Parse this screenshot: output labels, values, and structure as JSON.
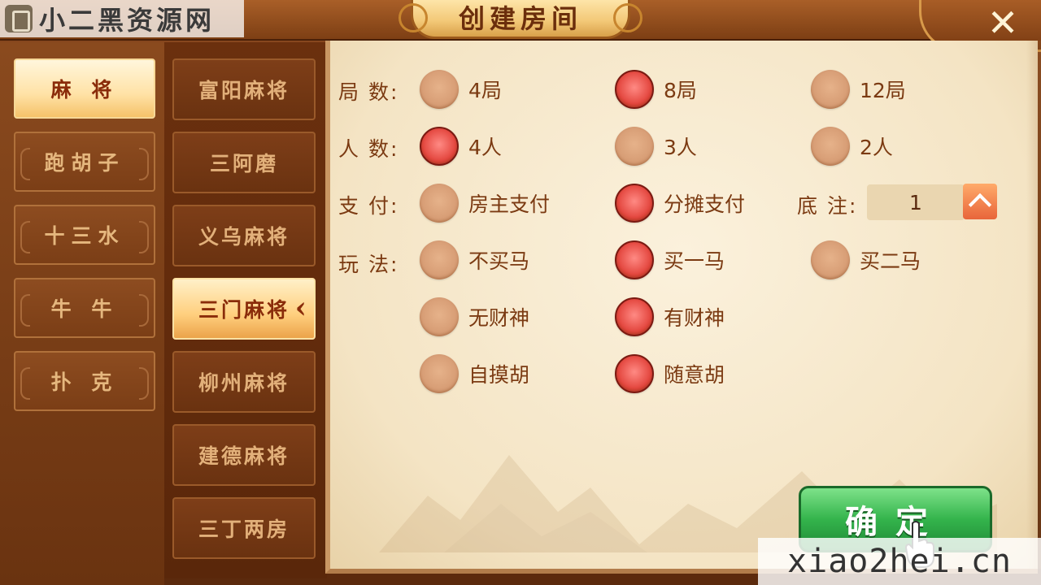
{
  "header": {
    "title": "创建房间",
    "watermark_top": "小二黑资源网",
    "close_symbol": "✕"
  },
  "categories": [
    {
      "label": "麻 将",
      "active": true
    },
    {
      "label": "跑胡子",
      "active": false
    },
    {
      "label": "十三水",
      "active": false
    },
    {
      "label": "牛 牛",
      "active": false
    },
    {
      "label": "扑 克",
      "active": false
    }
  ],
  "games": [
    {
      "label": "富阳麻将",
      "active": false
    },
    {
      "label": "三阿磨",
      "active": false
    },
    {
      "label": "义乌麻将",
      "active": false
    },
    {
      "label": "三门麻将",
      "active": true
    },
    {
      "label": "柳州麻将",
      "active": false
    },
    {
      "label": "建德麻将",
      "active": false
    },
    {
      "label": "三丁两房",
      "active": false
    }
  ],
  "settings": {
    "rounds": {
      "label": "局 数:",
      "options": [
        {
          "label": "4局",
          "selected": false
        },
        {
          "label": "8局",
          "selected": true
        },
        {
          "label": "12局",
          "selected": false
        }
      ]
    },
    "players": {
      "label": "人 数:",
      "options": [
        {
          "label": "4人",
          "selected": true
        },
        {
          "label": "3人",
          "selected": false
        },
        {
          "label": "2人",
          "selected": false
        }
      ]
    },
    "payment": {
      "label": "支 付:",
      "options": [
        {
          "label": "房主支付",
          "selected": false
        },
        {
          "label": "分摊支付",
          "selected": true
        }
      ]
    },
    "stake": {
      "label": "底 注:",
      "value": "1"
    },
    "play": {
      "label": "玩 法:",
      "rows": [
        [
          {
            "label": "不买马",
            "selected": false
          },
          {
            "label": "买一马",
            "selected": true
          },
          {
            "label": "买二马",
            "selected": false
          }
        ],
        [
          {
            "label": "无财神",
            "selected": false
          },
          {
            "label": "有财神",
            "selected": true
          }
        ],
        [
          {
            "label": "自摸胡",
            "selected": false
          },
          {
            "label": "随意胡",
            "selected": true
          }
        ]
      ]
    }
  },
  "confirm_label": "确定",
  "watermark_bottom": "xiao2hei.cn",
  "colors": {
    "accent_selected": "#e2433b",
    "confirm_green": "#34b44c",
    "text_brown": "#7b3a12"
  }
}
